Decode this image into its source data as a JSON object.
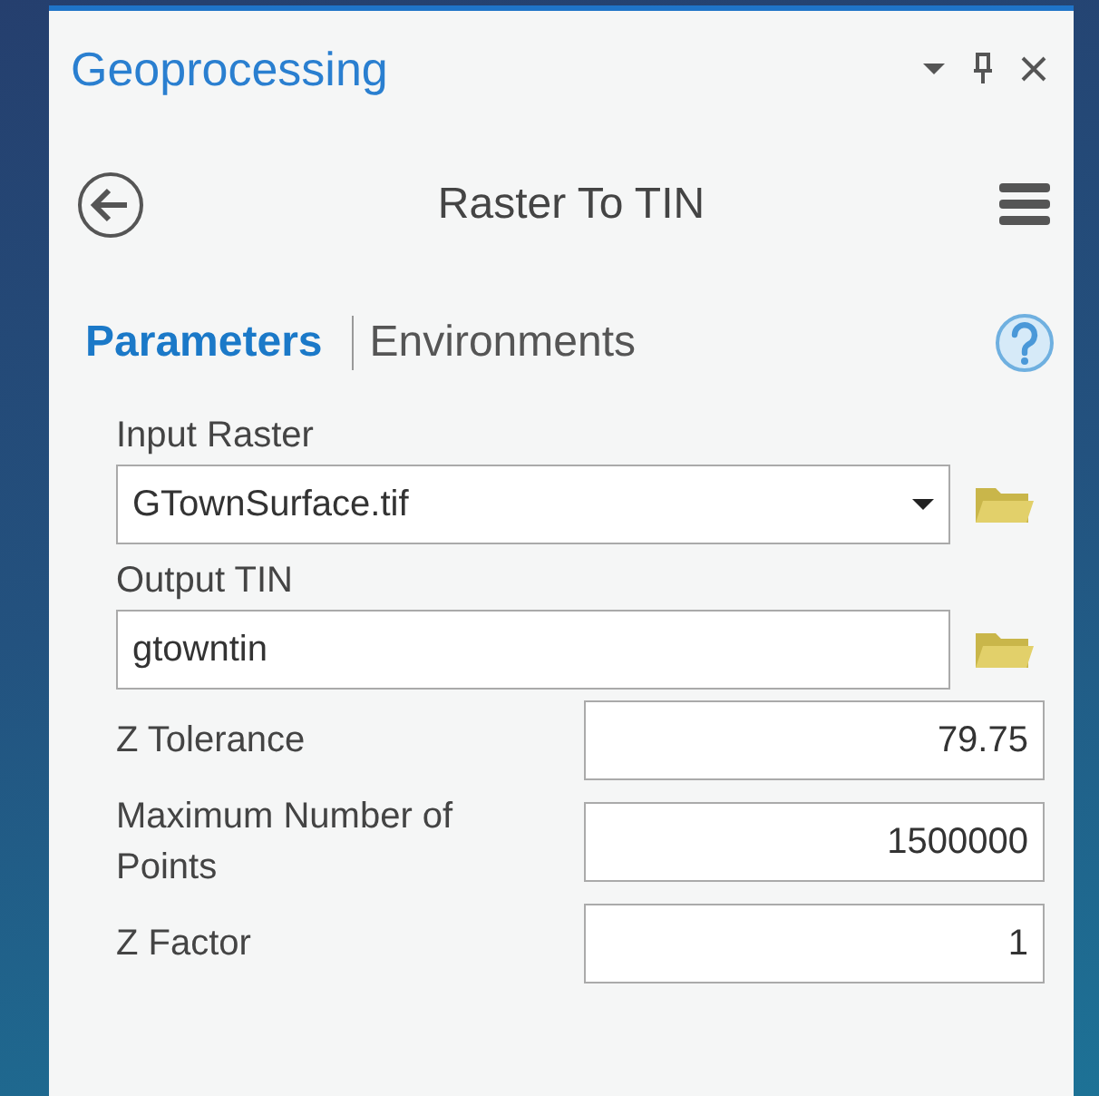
{
  "pane": {
    "title": "Geoprocessing"
  },
  "tool": {
    "title": "Raster To TIN"
  },
  "tabs": [
    {
      "label": "Parameters",
      "selected": true
    },
    {
      "label": "Environments",
      "selected": false
    }
  ],
  "parameters": [
    {
      "kind": "dropdown",
      "label": "Input Raster",
      "value": "GTownSurface.tif"
    },
    {
      "kind": "path",
      "label": "Output TIN",
      "value": "gtowntin"
    },
    {
      "kind": "number",
      "label": "Z Tolerance",
      "value": "79.75"
    },
    {
      "kind": "number",
      "label": "Maximum Number of Points",
      "value": "1500000"
    },
    {
      "kind": "number",
      "label": "Z Factor",
      "value": "1"
    }
  ]
}
